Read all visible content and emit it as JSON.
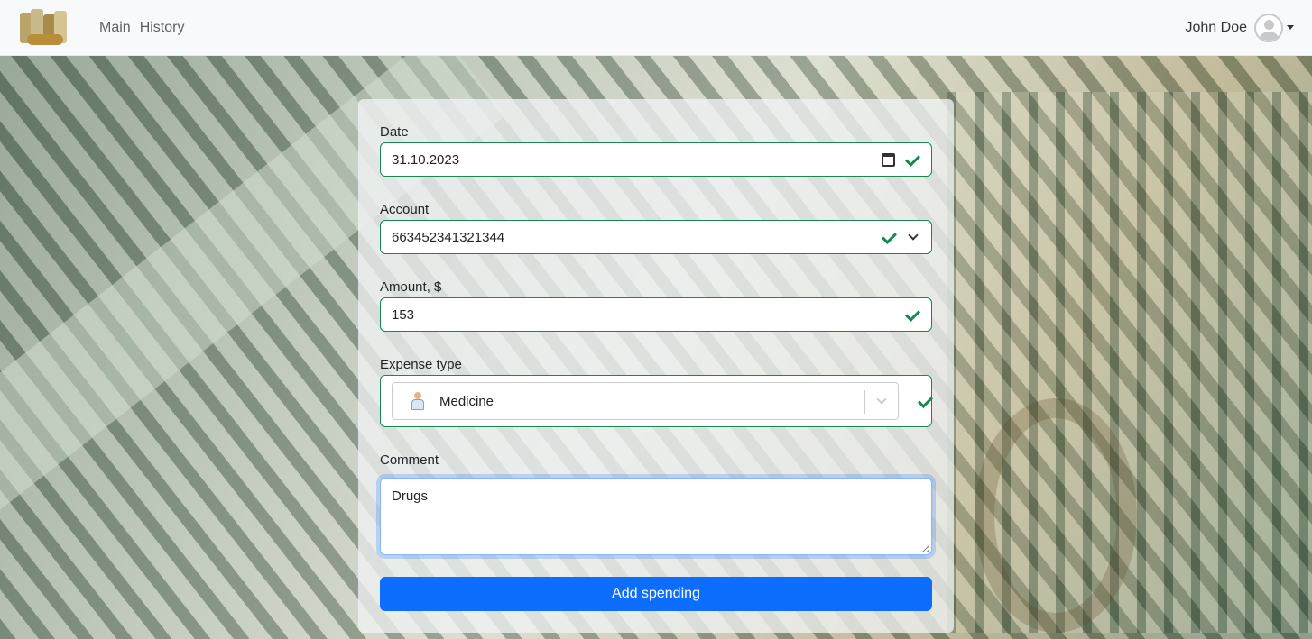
{
  "nav": {
    "logo_icon": "money-stack-icon",
    "links": [
      "Main",
      "History"
    ],
    "user_name": "John Doe",
    "avatar_icon": "user-avatar-icon"
  },
  "form": {
    "date": {
      "label": "Date",
      "value": "31.10.2023"
    },
    "account": {
      "label": "Account",
      "value": "663452341321344"
    },
    "amount": {
      "label": "Amount, $",
      "value": "153"
    },
    "expense_type": {
      "label": "Expense type",
      "value": "Medicine",
      "icon": "doctor-icon"
    },
    "comment": {
      "label": "Comment",
      "value": "Drugs"
    },
    "submit_label": "Add spending"
  },
  "colors": {
    "valid": "#198754",
    "primary": "#0d6efd",
    "focus": "#86b7fe"
  }
}
